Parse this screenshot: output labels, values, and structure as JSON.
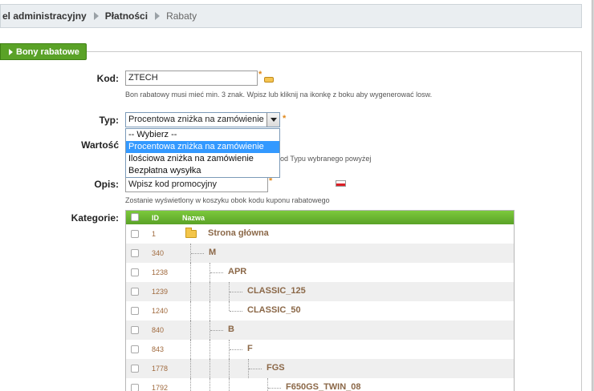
{
  "breadcrumb": {
    "items": [
      "el administracyjny",
      "Płatności",
      "Rabaty"
    ]
  },
  "panel": {
    "title": "Bony rabatowe"
  },
  "form": {
    "kod": {
      "label": "Kod:",
      "value": "ZTECH",
      "hint": "Bon rabatowy musi mieć min. 3 znak. Wpisz lub kliknij na ikonkę z boku aby wygenerować losw."
    },
    "typ": {
      "label": "Typ:",
      "selected": "Procentowa zniżka na zamówienie",
      "options": [
        "-- Wybierz --",
        "Procentowa zniżka na zamówienie",
        "Ilościowa zniżka na zamówienie",
        "Bezpłatna wysyłka"
      ]
    },
    "wartosc": {
      "label": "Wartość",
      "hint_suffix": "od Typu wybranego powyżej"
    },
    "opis": {
      "label": "Opis:",
      "value": "Wpisz kod promocyjny",
      "hint": "Zostanie wyświetlony w koszyku obok kodu kuponu rabatowego"
    },
    "kategorie": {
      "label": "Kategorie:"
    },
    "required_mark": "*"
  },
  "tree": {
    "headers": {
      "id": "ID",
      "name": "Nazwa"
    },
    "rows": [
      {
        "id": "1",
        "name": "Strona główna"
      },
      {
        "id": "340",
        "name": "M"
      },
      {
        "id": "1238",
        "name": "APR"
      },
      {
        "id": "1239",
        "name": "CLASSIC_125"
      },
      {
        "id": "1240",
        "name": "CLASSIC_50"
      },
      {
        "id": "840",
        "name": "B"
      },
      {
        "id": "843",
        "name": "F"
      },
      {
        "id": "1778",
        "name": "FGS"
      },
      {
        "id": "1792",
        "name": "F650GS_TWIN_08"
      }
    ]
  }
}
